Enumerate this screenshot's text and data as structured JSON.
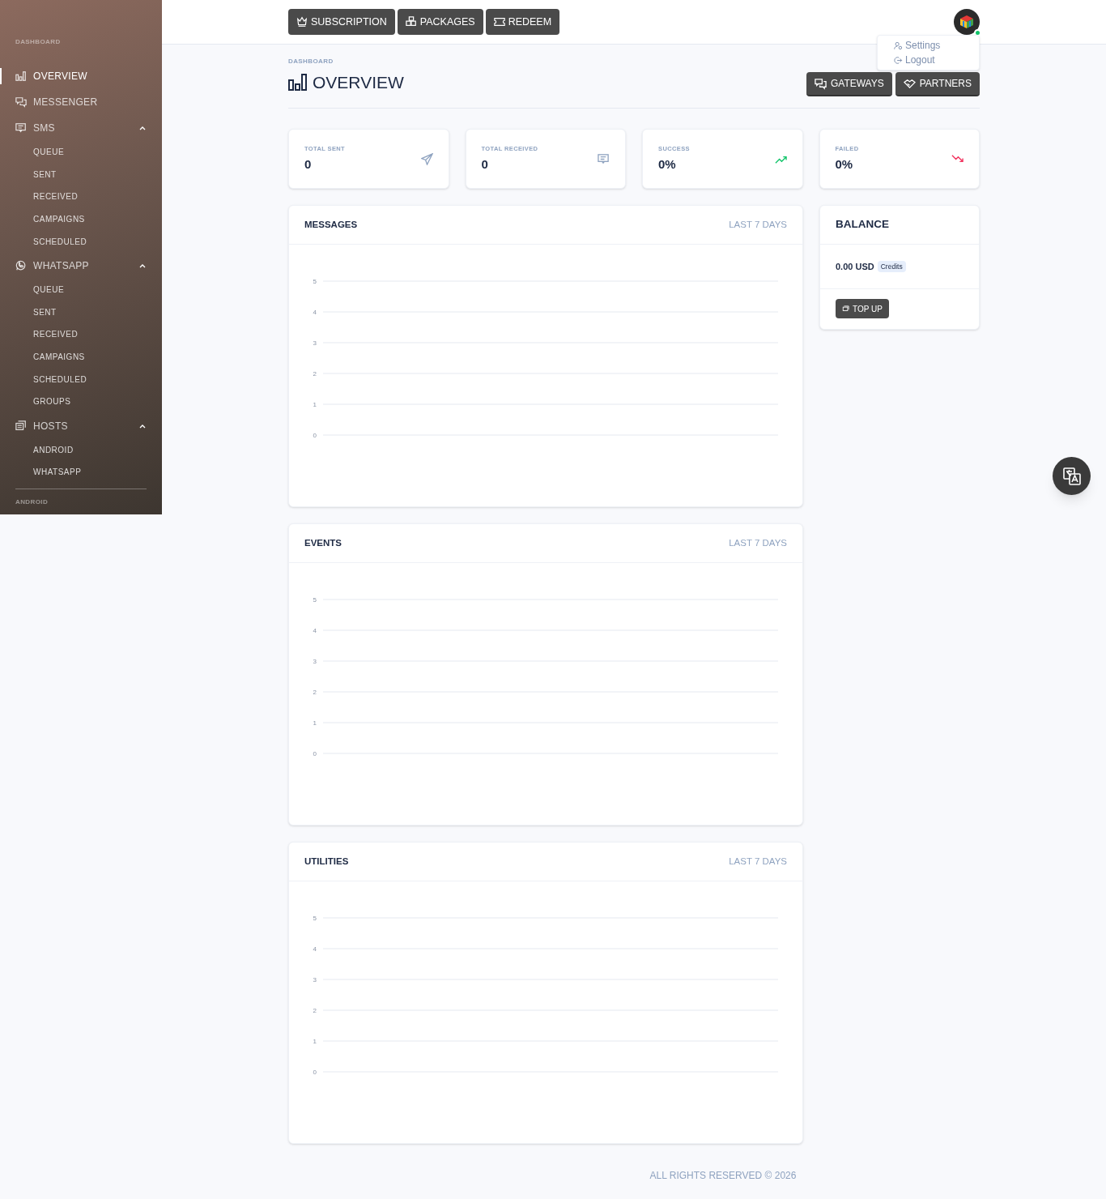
{
  "sidebar": {
    "sections": [
      {
        "label": "DASHBOARD",
        "items": [
          {
            "label": "OVERVIEW",
            "selected": true
          },
          {
            "label": "MESSENGER",
            "selected": false
          },
          {
            "label": "SMS",
            "selected": false,
            "expanded": true,
            "children": [
              {
                "label": "QUEUE"
              },
              {
                "label": "SENT"
              },
              {
                "label": "RECEIVED"
              },
              {
                "label": "CAMPAIGNS"
              },
              {
                "label": "SCHEDULED"
              }
            ]
          },
          {
            "label": "WHATSAPP",
            "selected": false,
            "expanded": true,
            "children": [
              {
                "label": "QUEUE"
              },
              {
                "label": "SENT"
              },
              {
                "label": "RECEIVED"
              },
              {
                "label": "CAMPAIGNS"
              },
              {
                "label": "SCHEDULED"
              },
              {
                "label": "GROUPS"
              }
            ]
          },
          {
            "label": "HOSTS",
            "selected": false,
            "expanded": true,
            "children": [
              {
                "label": "ANDROID"
              },
              {
                "label": "WHATSAPP"
              }
            ]
          }
        ]
      },
      {
        "label": "ANDROID"
      }
    ]
  },
  "topbar": {
    "buttons": [
      {
        "label": "SUBSCRIPTION"
      },
      {
        "label": "PACKAGES"
      },
      {
        "label": "REDEEM"
      }
    ],
    "user_online": true,
    "user_menu": [
      {
        "label": "Settings"
      },
      {
        "label": "Logout"
      }
    ]
  },
  "page": {
    "breadcrumb": "DASHBOARD",
    "title": "OVERVIEW",
    "actions": [
      {
        "label": "GATEWAYS"
      },
      {
        "label": "PARTNERS"
      }
    ]
  },
  "stats": [
    {
      "label": "TOTAL SENT",
      "value": "0",
      "color": "#8fa3c0"
    },
    {
      "label": "TOTAL RECEIVED",
      "value": "0",
      "color": "#8fa3c0"
    },
    {
      "label": "SUCCESS",
      "value": "0%",
      "color": "#10c469"
    },
    {
      "label": "FAILED",
      "value": "0%",
      "color": "#f1305c"
    }
  ],
  "charts": [
    {
      "title": "MESSAGES",
      "period": "LAST 7 DAYS",
      "chart_data": {
        "type": "line",
        "grid": true,
        "categories": [
          null,
          null,
          null,
          null,
          null,
          null,
          null
        ],
        "ylim": [
          0,
          5
        ],
        "yticks": [
          0,
          1,
          2,
          3,
          4,
          5
        ]
      }
    },
    {
      "title": "EVENTS",
      "period": "LAST 7 DAYS",
      "chart_data": {
        "type": "line",
        "grid": true,
        "categories": [
          null,
          null,
          null,
          null,
          null,
          null,
          null
        ],
        "ylim": [
          0,
          5
        ],
        "yticks": [
          0,
          1,
          2,
          3,
          4,
          5
        ]
      }
    },
    {
      "title": "UTILITIES",
      "period": "LAST 7 DAYS",
      "chart_data": {
        "type": "line",
        "grid": true,
        "categories": [
          null,
          null,
          null,
          null,
          null,
          null,
          null
        ],
        "ylim": [
          0,
          5
        ],
        "yticks": [
          0,
          1,
          2,
          3,
          4,
          5
        ]
      }
    }
  ],
  "balance": {
    "title": "BALANCE",
    "amount": "0.00 USD",
    "badge": "Credits",
    "button": "TOP UP"
  },
  "footer": "ALL RIGHTS RESERVED © 2026"
}
